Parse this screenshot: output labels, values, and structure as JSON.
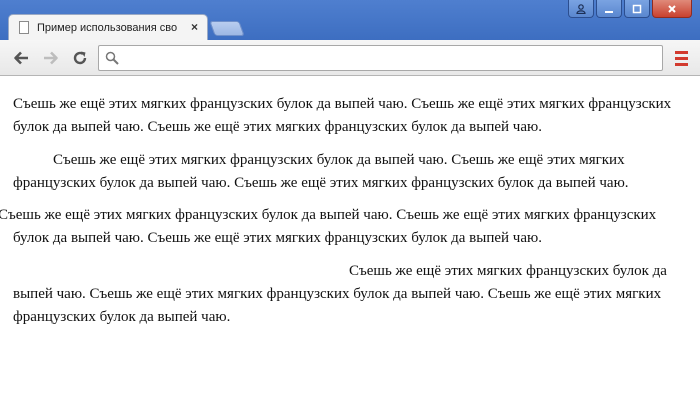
{
  "browser": {
    "tab": {
      "title": "Пример использования сво"
    },
    "toolbar": {
      "omnibox_value": "",
      "icons": [
        "back-arrow-icon",
        "forward-arrow-icon",
        "reload-icon",
        "search-icon",
        "menu-icon"
      ]
    },
    "window_controls": [
      "user-icon",
      "minimize-icon",
      "maximize-icon",
      "close-icon"
    ],
    "accent_colors": {
      "titlebar": "#3d6ec1",
      "menu": "#d23a2e"
    }
  },
  "content": {
    "paragraphs": [
      {
        "text": "Съешь же ещё этих мягких французских булок да выпей чаю. Съешь же ещё этих мягких французских булок да выпей чаю. Съешь же ещё этих мягких французских булок да выпей чаю."
      },
      {
        "text": "Съешь же ещё этих мягких французских булок да выпей чаю. Съешь же ещё этих мягких французских булок да выпей чаю. Съешь же ещё этих мягких французских булок да выпей чаю."
      },
      {
        "text": "Съешь же ещё этих мягких французских булок да выпей чаю. Съешь же ещё этих мягких французских булок да выпей чаю. Съешь же ещё этих мягких французских булок да выпей чаю."
      },
      {
        "text": "Съешь же ещё этих мягких французских булок да выпей чаю. Съешь же ещё этих мягких французских булок да выпей чаю. Съешь же ещё этих мягких французских булок да выпей чаю."
      }
    ]
  }
}
